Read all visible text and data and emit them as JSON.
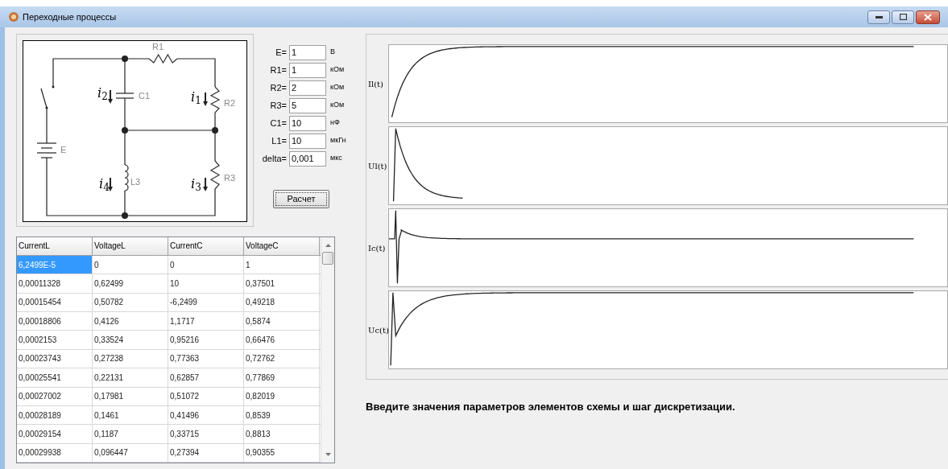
{
  "window": {
    "title": "Переходные процессы"
  },
  "circuit": {
    "labels": [
      {
        "text": "R1",
        "kind": "element"
      },
      {
        "text": "C1",
        "kind": "element"
      },
      {
        "text": "R2",
        "kind": "element"
      },
      {
        "text": "E",
        "kind": "element"
      },
      {
        "text": "L3",
        "kind": "element"
      },
      {
        "text": "R3",
        "kind": "element"
      },
      {
        "text": "*i*$_{2}$",
        "kind": "current"
      },
      {
        "text": "*i*$_{1}$",
        "kind": "current"
      },
      {
        "text": "*i*$_{4}$",
        "kind": "current"
      },
      {
        "text": "*i*$_{3}$",
        "kind": "current"
      }
    ]
  },
  "parameters": [
    {
      "label": "E=",
      "value": "1",
      "unit": "В"
    },
    {
      "label": "R1=",
      "value": "1",
      "unit": "кОм"
    },
    {
      "label": "R2=",
      "value": "2",
      "unit": "кОм"
    },
    {
      "label": "R3=",
      "value": "5",
      "unit": "кОм"
    },
    {
      "label": "C1=",
      "value": "10",
      "unit": "нФ"
    },
    {
      "label": "L1=",
      "value": "10",
      "unit": "мкГн"
    },
    {
      "label": "delta=",
      "value": "0,001",
      "unit": "мкс"
    }
  ],
  "calculate_button": "Расчет",
  "table": {
    "columns": [
      "CurrentL",
      "VoltageL",
      "CurrentC",
      "VoltageC"
    ],
    "rows": [
      {
        "cells": [
          "6,2499E-5",
          "0",
          "0",
          "1"
        ],
        "selected": true
      },
      {
        "cells": [
          "0,00011328",
          "0,62499",
          "10",
          "0,37501"
        ],
        "selected": false
      },
      {
        "cells": [
          "0,00015454",
          "0,50782",
          "-6,2499",
          "0,49218"
        ],
        "selected": false
      },
      {
        "cells": [
          "0,00018806",
          "0,4126",
          "1,1717",
          "0,5874"
        ],
        "selected": false
      },
      {
        "cells": [
          "0,0002153",
          "0,33524",
          "0,95216",
          "0,66476"
        ],
        "selected": false
      },
      {
        "cells": [
          "0,00023743",
          "0,27238",
          "0,77363",
          "0,72762"
        ],
        "selected": false
      },
      {
        "cells": [
          "0,00025541",
          "0,22131",
          "0,62857",
          "0,77869"
        ],
        "selected": false
      },
      {
        "cells": [
          "0,00027002",
          "0,17981",
          "0,51072",
          "0,82019"
        ],
        "selected": false
      },
      {
        "cells": [
          "0,00028189",
          "0,1461",
          "0,41496",
          "0,8539"
        ],
        "selected": false
      },
      {
        "cells": [
          "0,00029154",
          "0,1187",
          "0,33715",
          "0,8813"
        ],
        "selected": false
      },
      {
        "cells": [
          "0,00029938",
          "0,096447",
          "0,27394",
          "0,90355"
        ],
        "selected": false
      }
    ]
  },
  "charts": [
    {
      "label": "Il(t)",
      "kind": "rise"
    },
    {
      "label": "Ul(t)",
      "kind": "decay"
    },
    {
      "label": "Ic(t)",
      "kind": "ringing"
    },
    {
      "label": "Uc(t)",
      "kind": "overshoot"
    }
  ],
  "status": "Введите значения параметров элементов схемы и шаг дискретизации."
}
